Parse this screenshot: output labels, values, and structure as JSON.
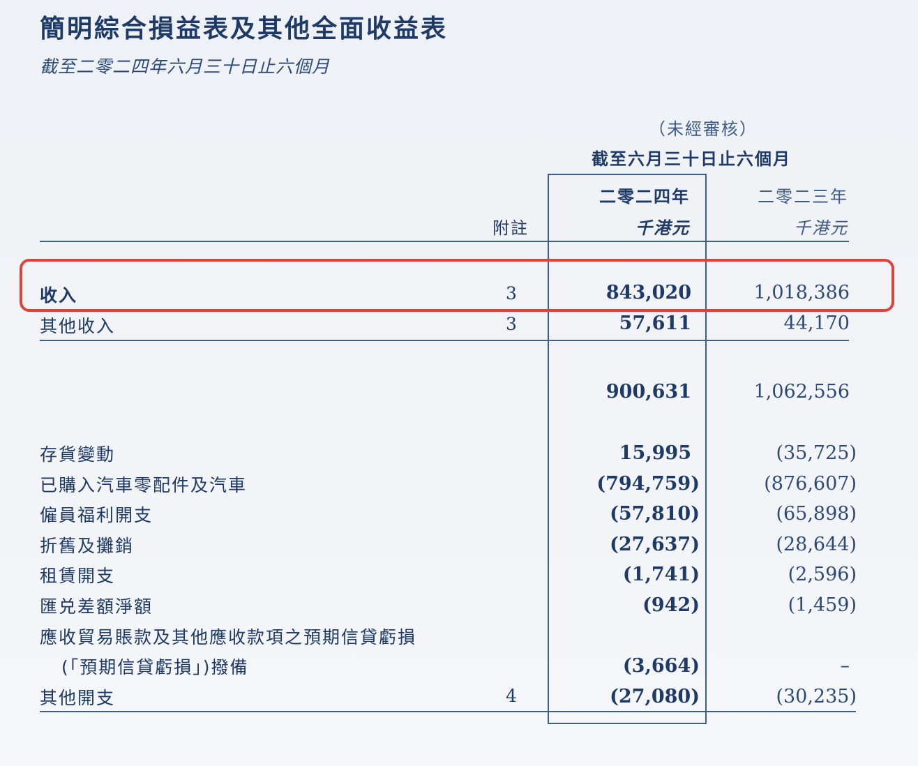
{
  "title": "簡明綜合損益表及其他全面收益表",
  "subtitle": "截至二零二四年六月三十日止六個月",
  "header": {
    "unaudited": "（未經審核）",
    "period": "截至六月三十日止六個月",
    "note_label": "附註",
    "col_2024": "二零二四年",
    "col_2023": "二零二三年",
    "unit_2024": "千港元",
    "unit_2023": "千港元"
  },
  "rows": [
    {
      "label": "收入",
      "note": "3",
      "v2024": "843,020",
      "v2023": "1,018,386"
    },
    {
      "label": "其他收入",
      "note": "3",
      "v2024": "57,611",
      "v2023": "44,170"
    },
    {
      "label": "",
      "note": "",
      "v2024": "900,631",
      "v2023": "1,062,556"
    },
    {
      "label": "存貨變動",
      "note": "",
      "v2024": "15,995",
      "v2023": "(35,725)"
    },
    {
      "label": "已購入汽車零配件及汽車",
      "note": "",
      "v2024": "(794,759)",
      "v2023": "(876,607)"
    },
    {
      "label": "僱員福利開支",
      "note": "",
      "v2024": "(57,810)",
      "v2023": "(65,898)"
    },
    {
      "label": "折舊及攤銷",
      "note": "",
      "v2024": "(27,637)",
      "v2023": "(28,644)"
    },
    {
      "label": "租賃開支",
      "note": "",
      "v2024": "(1,741)",
      "v2023": "(2,596)"
    },
    {
      "label": "匯兑差額淨額",
      "note": "",
      "v2024": "(942)",
      "v2023": "(1,459)"
    },
    {
      "label": "應收貿易賬款及其他應收款項之預期信貸虧損",
      "label2": "(「預期信貸虧損」)撥備",
      "note": "",
      "v2024": "(3,664)",
      "v2023": "–"
    },
    {
      "label": "其他開支",
      "note": "4",
      "v2024": "(27,080)",
      "v2023": "(30,235)"
    }
  ]
}
